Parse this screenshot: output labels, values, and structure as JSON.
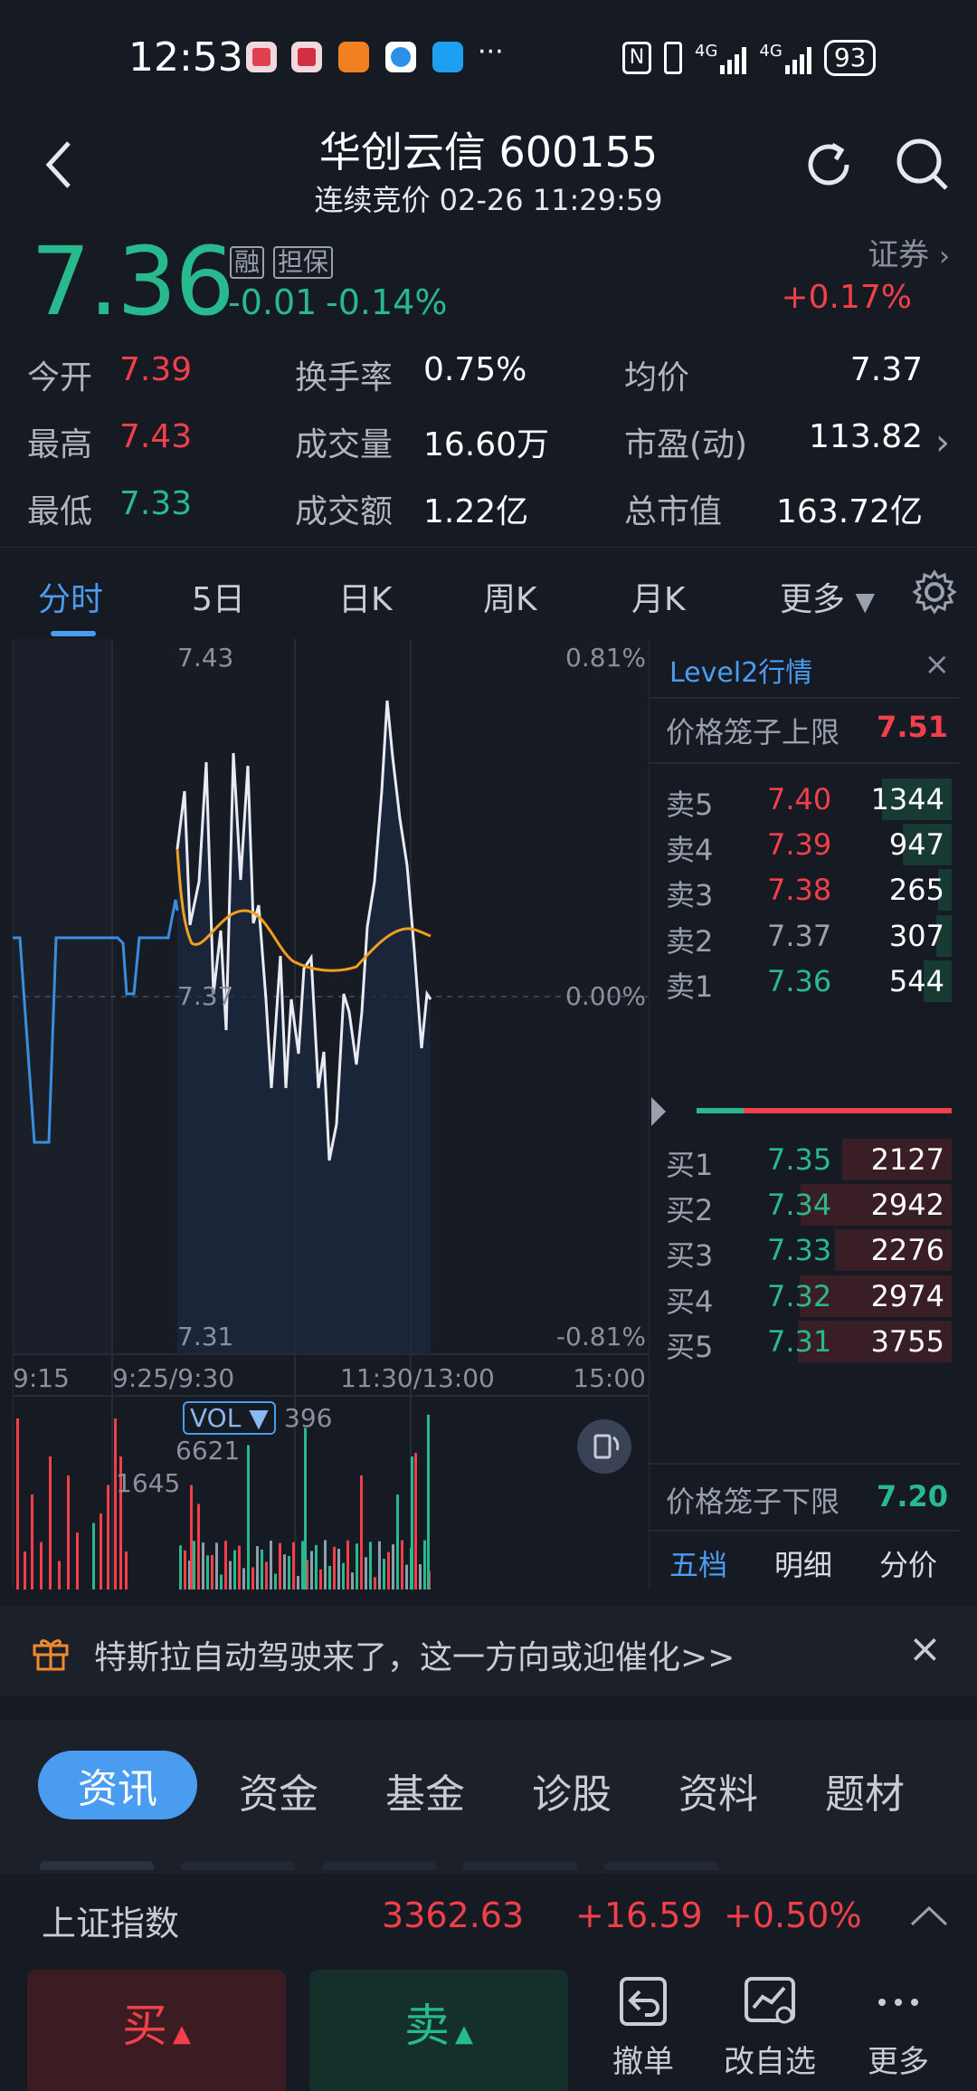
{
  "status_bar": {
    "time": "12:53",
    "more": "···",
    "network1": "4G",
    "network2": "4G",
    "battery": "93"
  },
  "header": {
    "title": "华创云信 600155",
    "subtitle": "连续竞价 02-26 11:29:59"
  },
  "quote": {
    "price": "7.36",
    "tag_margin": "融",
    "tag_guarantee": "担保",
    "change": "-0.01",
    "change_pct": "-0.14%",
    "sector": "证券",
    "sector_change": "+0.17%"
  },
  "stats": {
    "open_label": "今开",
    "open": "7.39",
    "high_label": "最高",
    "high": "7.43",
    "low_label": "最低",
    "low": "7.33",
    "turnover_label": "换手率",
    "turnover": "0.75%",
    "volume_label": "成交量",
    "volume": "16.60万",
    "amount_label": "成交额",
    "amount": "1.22亿",
    "avg_label": "均价",
    "avg": "7.37",
    "pe_label": "市盈(动)",
    "pe": "113.82",
    "mktcap_label": "总市值",
    "mktcap": "163.72亿"
  },
  "chart_tabs": [
    "分时",
    "5日",
    "日K",
    "周K",
    "月K",
    "更多"
  ],
  "chart": {
    "y_top": "7.43",
    "y_mid": "7.37",
    "y_bottom": "7.31",
    "pct_top": "0.81%",
    "pct_mid": "0.00%",
    "pct_bottom": "-0.81%",
    "x_labels": [
      "9:15",
      "9:25/9:30",
      "11:30/13:00",
      "15:00"
    ],
    "vol_label": "VOL ▼",
    "vol_value": "396",
    "vol_max": "6621",
    "vol_mid": "1645"
  },
  "level2": {
    "title": "Level2行情",
    "upper_limit_label": "价格笼子上限",
    "upper_limit": "7.51",
    "lower_limit_label": "价格笼子下限",
    "lower_limit": "7.20",
    "asks": [
      {
        "label": "卖5",
        "price": "7.40",
        "vol": "1344",
        "fill": 0.45
      },
      {
        "label": "卖4",
        "price": "7.39",
        "vol": "947",
        "fill": 0.32
      },
      {
        "label": "卖3",
        "price": "7.38",
        "vol": "265",
        "fill": 0.09
      },
      {
        "label": "卖2",
        "price": "7.37",
        "vol": "307",
        "fill": 0.1
      },
      {
        "label": "卖1",
        "price": "7.36",
        "vol": "544",
        "fill": 0.18
      }
    ],
    "bids": [
      {
        "label": "买1",
        "price": "7.35",
        "vol": "2127",
        "fill": 0.71
      },
      {
        "label": "买2",
        "price": "7.34",
        "vol": "2942",
        "fill": 0.98
      },
      {
        "label": "买3",
        "price": "7.33",
        "vol": "2276",
        "fill": 0.76
      },
      {
        "label": "买4",
        "price": "7.32",
        "vol": "2974",
        "fill": 0.99
      },
      {
        "label": "买5",
        "price": "7.31",
        "vol": "3755",
        "fill": 1.0
      }
    ],
    "footer_tabs": [
      "五档",
      "明细",
      "分价"
    ]
  },
  "banner": {
    "text": "特斯拉自动驾驶来了，这一方向或迎催化>>"
  },
  "info_tabs": [
    "资讯",
    "资金",
    "基金",
    "诊股",
    "资料",
    "题材"
  ],
  "index_bar": {
    "name": "上证指数",
    "value": "3362.63",
    "change": "+16.59",
    "change_pct": "+0.50%"
  },
  "actions": {
    "buy": "买",
    "sell": "卖",
    "cancel": "撤单",
    "watchlist": "改自选",
    "more": "更多"
  },
  "colors": {
    "up": "#f2404a",
    "down": "#28b98c",
    "accent": "#4a9cf0",
    "avg_line": "#f0a020"
  }
}
